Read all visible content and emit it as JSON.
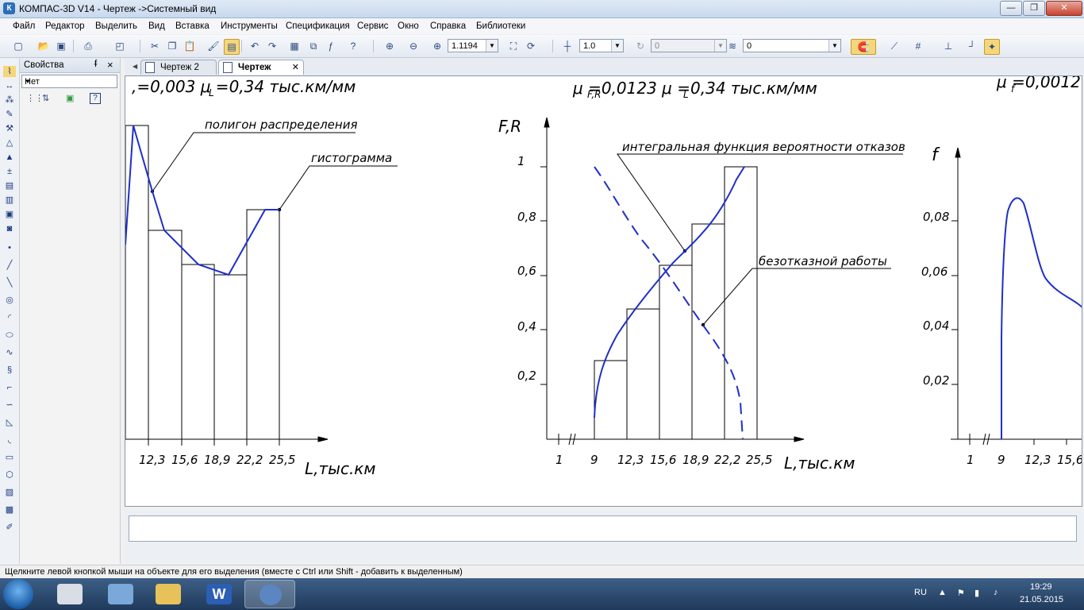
{
  "window": {
    "title": "КОМПАС-3D V14 - Чертеж ->Системный вид",
    "app_icon": "К",
    "controls": [
      "—",
      "❐",
      "✕"
    ]
  },
  "menu": [
    "Файл",
    "Редактор",
    "Выделить",
    "Вид",
    "Вставка",
    "Инструменты",
    "Спецификация",
    "Сервис",
    "Окно",
    "Справка",
    "Библиотеки"
  ],
  "toolbar": {
    "zoom_value": "1.1194",
    "step_value": "1.0",
    "angle_value": "0",
    "layer_value": "0"
  },
  "properties_panel": {
    "title": "Свойства",
    "pin": "ᵮ",
    "close": "×",
    "selection": "Нет"
  },
  "tabs": [
    {
      "label": "Чертеж 2",
      "active": false
    },
    {
      "label": "Чертеж",
      "active": true
    }
  ],
  "drawing": {
    "header_left": ",=0,003 μ  =0,34  тыс.км/мм",
    "header_left_sub": "L",
    "header_mid": "μ      =0,0123 μ  =0,34  тыс.км/мм",
    "header_mid_sub1": "F,R",
    "header_mid_sub2": "L",
    "header_right": "μ  =0,0012",
    "header_right_sub": "f",
    "left_chart": {
      "label_polygon": "полигон распределения",
      "label_histogram": "гистограмма",
      "x_ticks": [
        "12,3",
        "15,6",
        "18,9",
        "22,2",
        "25,5"
      ],
      "x_axis_label": "L,тыс.км"
    },
    "mid_chart": {
      "y_axis_label": "F,R",
      "y_ticks": [
        "1",
        "0,8",
        "0,6",
        "0,4",
        "0,2"
      ],
      "x_ticks": [
        "1",
        "9",
        "12,3",
        "15,6",
        "18,9",
        "22,2",
        "25,5"
      ],
      "x_axis_label": "L,тыс.км",
      "label_integral": "интегральная функция вероятности отказов",
      "label_reliability": "безотказной работы"
    },
    "right_chart": {
      "y_axis_label": "f",
      "y_ticks": [
        "0,08",
        "0,06",
        "0,04",
        "0,02"
      ],
      "x_ticks": [
        "1",
        "9",
        "12,3",
        "15,6"
      ]
    }
  },
  "status": "Щелкните левой кнопкой мыши на объекте для его выделения (вместе с Ctrl или Shift - добавить к выделенным)",
  "taskbar": {
    "lang": "RU",
    "time": "19:29",
    "date": "21.05.2015",
    "word_icon": "W"
  },
  "colors": {
    "curve": "#1f2fc8",
    "accent": "#2d6fb7"
  }
}
